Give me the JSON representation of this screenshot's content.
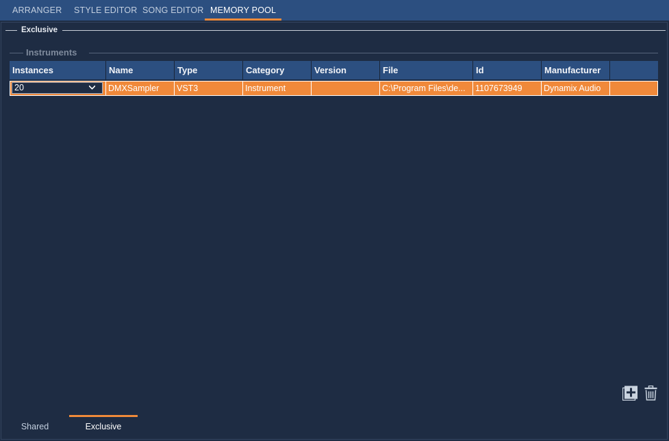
{
  "top_tabs": [
    {
      "label": "ARRANGER",
      "active": false
    },
    {
      "label": "STYLE EDITOR",
      "active": false
    },
    {
      "label": "SONG EDITOR",
      "active": false
    },
    {
      "label": "MEMORY POOL",
      "active": true
    }
  ],
  "section": {
    "title": "Exclusive"
  },
  "group": {
    "title": "Instruments"
  },
  "table": {
    "headers": [
      "Instances",
      "Name",
      "Type",
      "Category",
      "Version",
      "File",
      "Id",
      "Manufacturer"
    ],
    "rows": [
      {
        "instances": "20",
        "name": "DMXSampler",
        "type": "VST3",
        "category": "Instrument",
        "version": "",
        "file": "C:\\Program Files\\de...",
        "id": "1107673949",
        "manufacturer": "Dynamix Audio",
        "selected": true
      }
    ]
  },
  "toolbar": {
    "add_icon": "add-square-icon",
    "delete_icon": "trash-icon"
  },
  "bottom_tabs": [
    {
      "label": "Shared",
      "active": false
    },
    {
      "label": "Exclusive",
      "active": true
    }
  ],
  "colors": {
    "accent": "#f08a3a",
    "header": "#2c4f80",
    "background": "#1f2d44"
  }
}
